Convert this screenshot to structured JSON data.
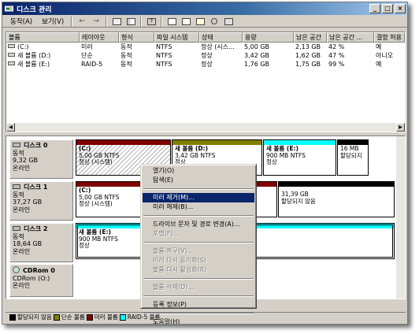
{
  "window": {
    "title": "디스크 관리",
    "controls": [
      "_",
      "□",
      "×"
    ]
  },
  "menubar": {
    "items": [
      "동작(A)",
      "보기(V)"
    ]
  },
  "volumes": {
    "columns": [
      "볼륨",
      "레이아웃",
      "형식",
      "파일 시스템",
      "상태",
      "용량",
      "남은 공간",
      "남은 공간 ...",
      "결함 허용"
    ],
    "rows": [
      {
        "vol": "(C:)",
        "layout": "미러",
        "type": "동적",
        "fs": "NTFS",
        "status": "정상 (시스...",
        "cap": "5,00 GB",
        "free": "2,13 GB",
        "pct": "42 %",
        "fault": "예"
      },
      {
        "vol": "새 볼륨 (D:)",
        "layout": "단순",
        "type": "동적",
        "fs": "NTFS",
        "status": "정상",
        "cap": "3,42 GB",
        "free": "1,62 GB",
        "pct": "47 %",
        "fault": "아니오"
      },
      {
        "vol": "새 볼륨 (E:)",
        "layout": "RAID-5",
        "type": "동적",
        "fs": "NTFS",
        "status": "정상",
        "cap": "1,76 GB",
        "free": "1,75 GB",
        "pct": "99 %",
        "fault": "예"
      }
    ]
  },
  "disks": [
    {
      "name": "디스크 0",
      "type": "동적",
      "size": "9,32 GB",
      "state": "온라인"
    },
    {
      "name": "디스크 1",
      "type": "동적",
      "size": "37,27 GB",
      "state": "온라인"
    },
    {
      "name": "디스크 2",
      "type": "동적",
      "size": "18,64 GB",
      "state": "온라인"
    },
    {
      "name": "CDRom 0",
      "type": "CDRom (O:)",
      "size": "",
      "state": "온라인"
    }
  ],
  "partitions": {
    "d0_c": {
      "name": "(C:)",
      "size": "5,00 GB NTFS",
      "status": "정상 (시스템)"
    },
    "d0_d": {
      "name": "새 볼륨  (D:)",
      "size": "3,42 GB NTFS",
      "status": "정상"
    },
    "d0_e": {
      "name": "새 볼륨  (E:)",
      "size": "900 MB NTFS",
      "status": "정상"
    },
    "d0_u": {
      "name": "",
      "size": "16 MB",
      "status": "할당되지"
    },
    "d1_c": {
      "name": "(C:)",
      "size": "5,00 GB NTFS",
      "status": "정상 (시스템)"
    },
    "d1_u": {
      "name": "",
      "size": "31,39 GB",
      "status": "할당되지 않음"
    },
    "d2_e": {
      "name": "새 볼륨  (E:)",
      "size": "900 MB NTFS",
      "status": "정상"
    }
  },
  "legend": [
    "할당되지 않음",
    "단순 볼륨",
    "미러 볼륨",
    "RAID-5 볼륨"
  ],
  "context_menu": [
    {
      "label": "열기(O)",
      "state": "normal"
    },
    {
      "label": "탐색(E)",
      "state": "normal"
    },
    {
      "sep": true
    },
    {
      "label": "미러 제거(M)...",
      "state": "highlight"
    },
    {
      "label": "미러 해제(B)...",
      "state": "normal"
    },
    {
      "sep": true
    },
    {
      "label": "드라이브 문자 및 경로 변경(A)...",
      "state": "normal"
    },
    {
      "label": "포맷(F)...",
      "state": "disabled"
    },
    {
      "sep": true
    },
    {
      "label": "볼륨 복구(V)...",
      "state": "disabled"
    },
    {
      "label": "미러 다시 동기화(S)",
      "state": "disabled"
    },
    {
      "label": "볼륨 다시 활성화(R)",
      "state": "disabled"
    },
    {
      "sep": true
    },
    {
      "label": "볼륨 삭제(D)...",
      "state": "disabled"
    },
    {
      "sep": true
    },
    {
      "label": "등록 정보(P)",
      "state": "normal"
    },
    {
      "sep": true
    },
    {
      "label": "도움말(H)",
      "state": "normal"
    }
  ],
  "colors": {
    "unallocated": "#000000",
    "simple": "#808000",
    "mirror": "#800000",
    "raid5": "#00ffff"
  }
}
